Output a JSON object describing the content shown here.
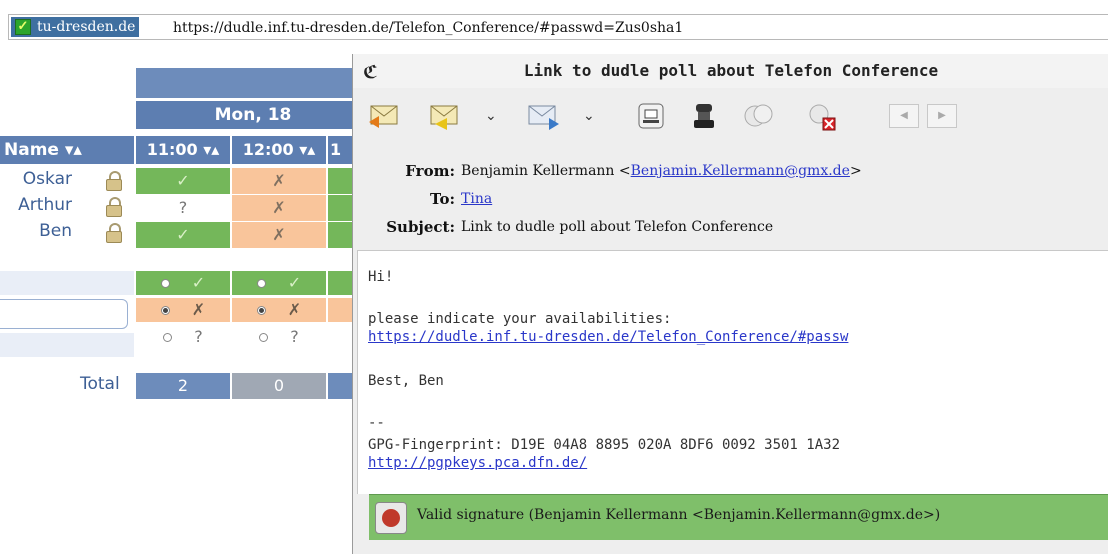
{
  "urlbar": {
    "site_identity": "tu-dresden.de",
    "url": "https://dudle.inf.tu-dresden.de/Telefon_Conference/#passwd=Zus0sha1"
  },
  "poll": {
    "day_header": "Mon, 18",
    "name_header": "Name ▾▴",
    "time_headers": [
      "11:00 ▾▴",
      "12:00 ▾▴",
      "1"
    ],
    "participants": [
      {
        "name": "Oskar",
        "votes": [
          "✓",
          "✗"
        ]
      },
      {
        "name": "Arthur",
        "votes": [
          "?",
          "✗"
        ]
      },
      {
        "name": "Ben",
        "votes": [
          "✓",
          "✗"
        ]
      }
    ],
    "vote_options": [
      "✓",
      "✗",
      "?"
    ],
    "total_label": "Total",
    "totals": [
      "2",
      "0"
    ]
  },
  "mail": {
    "title": "Link to dudle poll about Telefon Conference",
    "from_label": "From:",
    "from_name": "Benjamin Kellermann <",
    "from_email": "Benjamin.Kellermann@gmx.de",
    "from_close": ">",
    "to_label": "To:",
    "to_value": "Tina",
    "subject_label": "Subject:",
    "subject_value": "Link to dudle poll about Telefon Conference",
    "body": {
      "greeting": "Hi!",
      "line1": "please indicate your availabilities:",
      "link1": "https://dudle.inf.tu-dresden.de/Telefon_Conference/#passw",
      "closing": "Best, Ben",
      "sep": "--",
      "fingerprint": "GPG-Fingerprint: D19E 04A8 8895 020A 8DF6  0092 3501 1A32",
      "keys_link": "http://pgpkeys.pca.dfn.de/"
    },
    "signature": "Valid signature (Benjamin Kellermann <Benjamin.Kellermann@gmx.de>)"
  },
  "colors": {
    "yes": "#74b75a",
    "no": "#f9c59b",
    "header": "#5d7eb1",
    "signature": "#7fbf6a"
  }
}
